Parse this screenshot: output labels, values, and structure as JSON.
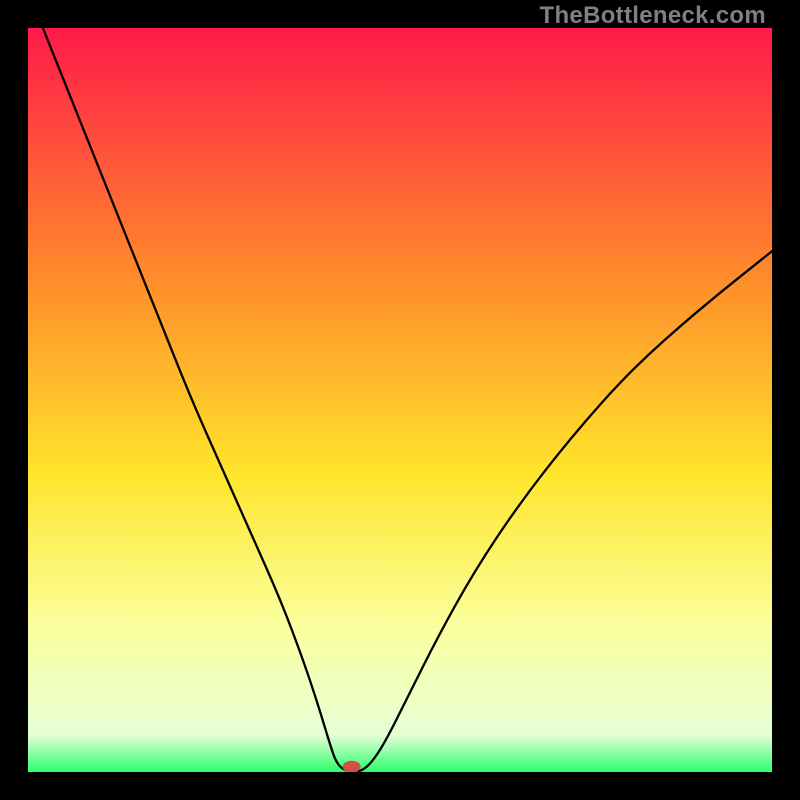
{
  "watermark": "TheBottleneck.com",
  "chart_data": {
    "type": "line",
    "title": "",
    "xlabel": "",
    "ylabel": "",
    "xlim": [
      0,
      100
    ],
    "ylim": [
      0,
      100
    ],
    "grid": false,
    "legend": false,
    "background_gradient": {
      "stops": [
        {
          "offset": 0.0,
          "color": "#ff1a4a"
        },
        {
          "offset": 0.33,
          "color": "#ff8a2b"
        },
        {
          "offset": 0.6,
          "color": "#ffe52b"
        },
        {
          "offset": 0.8,
          "color": "#fbff9c"
        },
        {
          "offset": 0.95,
          "color": "#e6ffd6"
        },
        {
          "offset": 1.0,
          "color": "#2cff6e"
        }
      ]
    },
    "series": [
      {
        "name": "bottleneck-curve",
        "color": "#000000",
        "x": [
          2,
          6,
          10,
          14,
          18,
          22,
          26,
          30,
          34,
          37,
          39,
          40.5,
          41.5,
          43,
          44.5,
          46,
          48,
          51,
          55,
          60,
          66,
          73,
          81,
          90,
          100
        ],
        "y": [
          100,
          90,
          80,
          70,
          60,
          50,
          41,
          32,
          23,
          15,
          9,
          4,
          1,
          0,
          0,
          1,
          4,
          10,
          18,
          27,
          36,
          45,
          54,
          62,
          70
        ]
      }
    ],
    "marker": {
      "name": "bottleneck-point",
      "x": 43.5,
      "y": 0.7,
      "color": "#d05048",
      "rx": 9,
      "ry": 6
    }
  }
}
